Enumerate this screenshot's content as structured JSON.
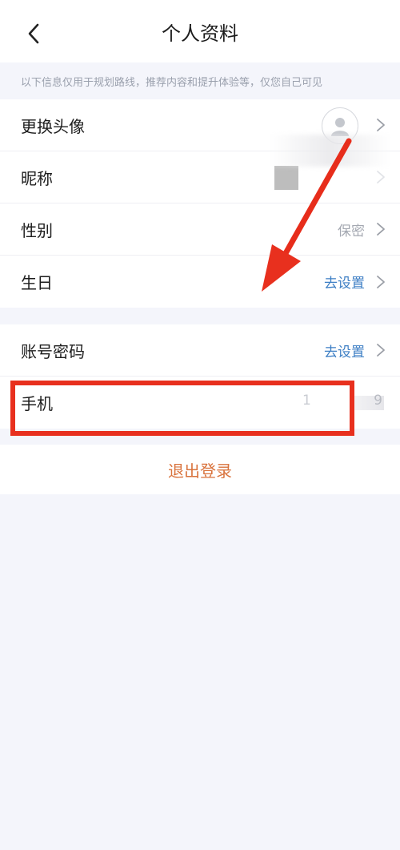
{
  "header": {
    "title": "个人资料",
    "back_icon": "chevron-left-icon"
  },
  "notice": {
    "text": "以下信息仅用于规划路线，推荐内容和提升体验等，仅您自己可见"
  },
  "profile": {
    "items": [
      {
        "label": "更换头像",
        "value": ""
      },
      {
        "label": "昵称",
        "value": ""
      },
      {
        "label": "性别",
        "value": "保密"
      },
      {
        "label": "生日",
        "value": "去设置"
      }
    ]
  },
  "account": {
    "items": [
      {
        "label": "账号密码",
        "value": "去设置"
      },
      {
        "label": "手机",
        "value_start": "1",
        "value_end": "9"
      }
    ]
  },
  "logout": {
    "label": "退出登录"
  },
  "colors": {
    "link": "#3c7ec4",
    "logout": "#d9733d",
    "annotation": "#e8301e"
  }
}
